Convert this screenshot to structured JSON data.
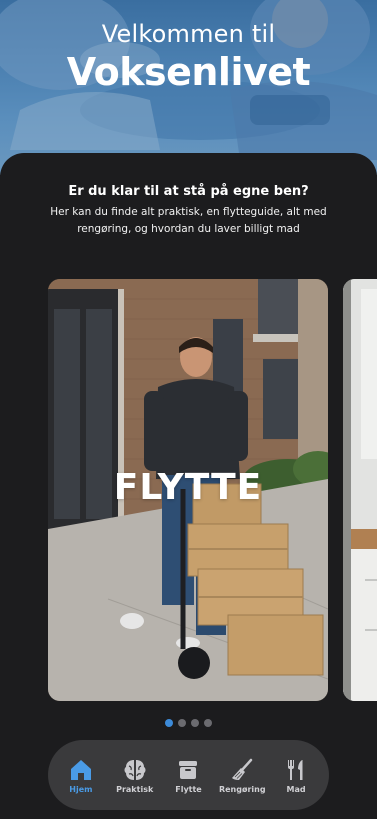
{
  "hero": {
    "greeting": "Velkommen til",
    "brand": "Voksenlivet"
  },
  "intro": {
    "heading": "Er du klar til at stå på egne ben?",
    "text": "Her kan du finde alt praktisk, en flytteguide, alt med rengøring, og hvordan du laver billigt mad"
  },
  "carousel": {
    "cards": [
      {
        "label": "FLYTTE",
        "image": "man-moving-boxes-photo"
      },
      {
        "label": "",
        "image": "kitchen-interior-photo"
      }
    ],
    "page_count": 4,
    "active_page": 1
  },
  "nav": {
    "items": [
      {
        "label": "Hjem",
        "icon": "home-icon",
        "active": true
      },
      {
        "label": "Praktisk",
        "icon": "brain-icon",
        "active": false
      },
      {
        "label": "Flytte",
        "icon": "box-icon",
        "active": false
      },
      {
        "label": "Rengøring",
        "icon": "broom-icon",
        "active": false
      },
      {
        "label": "Mad",
        "icon": "fork-knife-icon",
        "active": false
      }
    ]
  },
  "colors": {
    "accent": "#3d8bd9",
    "background": "#1c1c1e",
    "nav_background": "#3a3a3c"
  }
}
